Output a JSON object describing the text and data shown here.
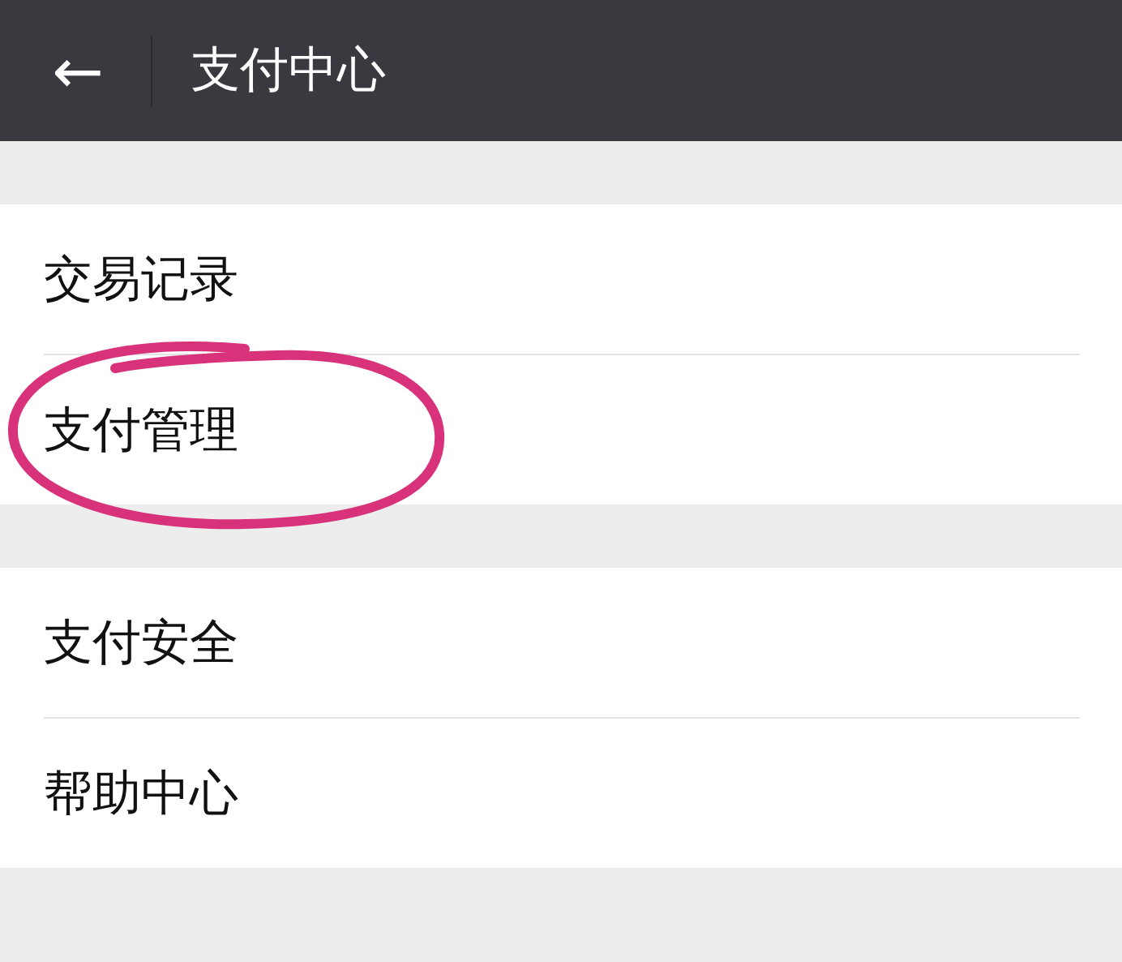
{
  "header": {
    "back": "←",
    "title": "支付中心"
  },
  "groups": [
    {
      "items": [
        {
          "label": "交易记录",
          "circled": false
        },
        {
          "label": "支付管理",
          "circled": true
        }
      ]
    },
    {
      "items": [
        {
          "label": "支付安全",
          "circled": false
        },
        {
          "label": "帮助中心",
          "circled": false
        }
      ]
    }
  ]
}
